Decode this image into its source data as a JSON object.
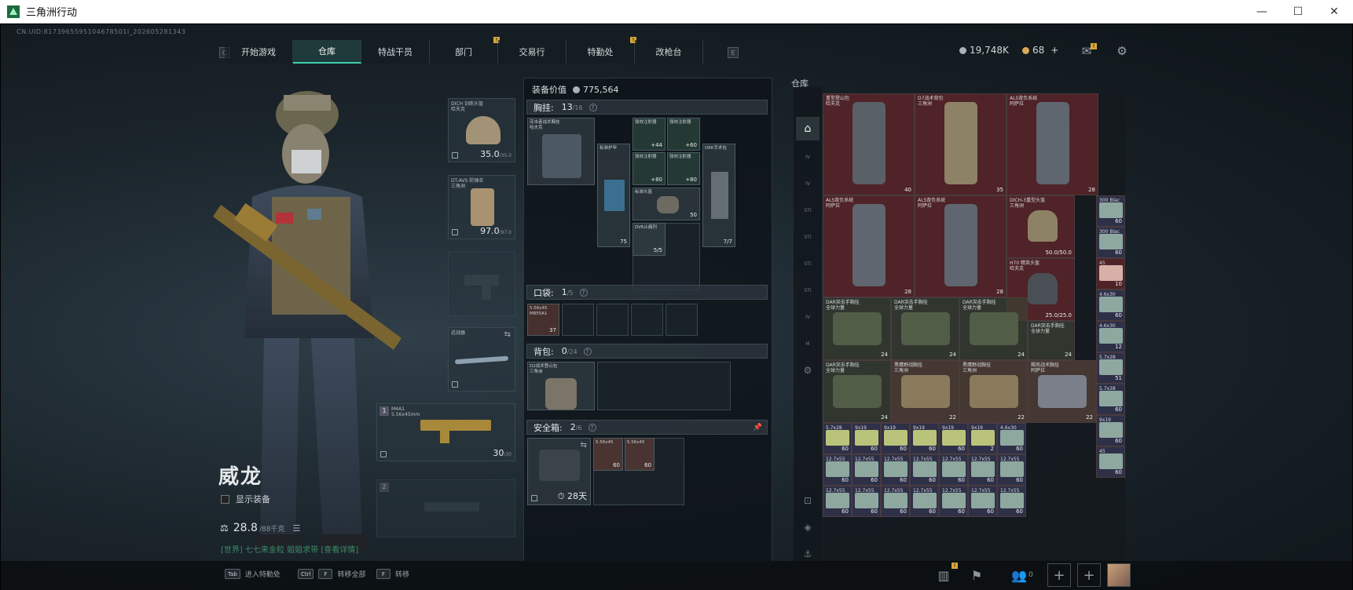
{
  "window": {
    "title": "三角洲行动",
    "minimize": "—",
    "maximize": "☐",
    "close": "✕"
  },
  "uid": "CN.UID:8173965595104678501I_202605281343",
  "nav": {
    "left_key": "Q",
    "right_key": "E",
    "tabs": [
      {
        "label": "开始游戏",
        "active": false,
        "badge": ""
      },
      {
        "label": "仓库",
        "active": true,
        "badge": ""
      },
      {
        "label": "特战干员",
        "active": false,
        "badge": ""
      },
      {
        "label": "部门",
        "active": false,
        "badge": "!"
      },
      {
        "label": "交易行",
        "active": false,
        "badge": ""
      },
      {
        "label": "特勤处",
        "active": false,
        "badge": "!"
      },
      {
        "label": "改枪台",
        "active": false,
        "badge": ""
      }
    ]
  },
  "currency": {
    "silver": "19,748K",
    "gold": "68",
    "plus": "+",
    "mail_badge": "!"
  },
  "character": {
    "name": "威龙",
    "show_equipment": "显示装备",
    "weight": "28.8",
    "weight_max": "/88千克",
    "chat": "[世界] 七七来金粒 姐姐求带 [查看详情]"
  },
  "gear": {
    "helmet": {
      "label": "DICH 训练头盔\n哈夫克",
      "value": "35.0",
      "max": "/35.0"
    },
    "armor": {
      "label": "DT-AVS 防弹衣\n三角洲",
      "value": "97.0",
      "max": "/97.0"
    },
    "melee": {
      "label": "近战器"
    },
    "primary": {
      "index": "1",
      "label": "M4A1\n5.56x45mm",
      "ammo": "30",
      "ammo_max": "/30"
    },
    "secondary": {
      "index": "2"
    }
  },
  "loadout": {
    "value_label": "装备价值",
    "value": "775,564",
    "chest": {
      "label": "胸挂:",
      "count": "13",
      "max": "/16",
      "rig": "突击者战术胸挂\n哈夫克",
      "items": [
        {
          "label": "标准护甲",
          "num": "75"
        },
        {
          "label": "强效注射器",
          "num": "+44"
        },
        {
          "label": "强效注射器",
          "num": "+60"
        },
        {
          "label": "强效注射器",
          "num": "+80"
        },
        {
          "label": "强效注射器",
          "num": "+80"
        },
        {
          "label": "DEK手术包",
          "num": "7/7"
        },
        {
          "label": "标准头盔",
          "num": "50"
        },
        {
          "label": "DV6止痛剂",
          "num": "5/5"
        }
      ]
    },
    "pocket": {
      "label": "口袋:",
      "count": "1",
      "max": "/5",
      "item": "5.56x45\nM855A1",
      "num": "37"
    },
    "backpack": {
      "label": "背包:",
      "count": "0",
      "max": "/24",
      "item": "D2战术登山包\n三角洲"
    },
    "safe": {
      "label": "安全箱:",
      "count": "2",
      "max": "/6",
      "days": "28天",
      "items": [
        {
          "label": "5.56x45",
          "num": "60"
        },
        {
          "label": "5.56x45",
          "num": "60"
        }
      ]
    }
  },
  "stash": {
    "title": "仓库",
    "items": [
      {
        "label": "重型登山包\n哈夫克",
        "num": "40"
      },
      {
        "label": "D7战术背包\n三角洲",
        "num": "35"
      },
      {
        "label": "ALS背负系统\n阿萨拉",
        "num": "28"
      },
      {
        "label": "ALS背负系统\n阿萨拉",
        "num": "28"
      },
      {
        "label": "ALS背负系统\n阿萨拉",
        "num": "28"
      },
      {
        "label": "DICH-3重型头盔\n三角洲",
        "num": "50.0/50.0"
      },
      {
        "label": "H70 精英头盔\n哈夫克",
        "num": "25.0/25.0"
      },
      {
        "label": "DAR突击手胸挂\n全球力量",
        "num": "24"
      },
      {
        "label": "DAR突击手胸挂\n全球力量",
        "num": "24"
      },
      {
        "label": "DAR突击手胸挂\n全球力量",
        "num": "24"
      },
      {
        "label": "DAR突击手胸挂\n全球力量",
        "num": "24"
      },
      {
        "label": "DAR突击手胸挂\n全球力量",
        "num": "24"
      },
      {
        "label": "黑鹰野战胸挂\n三角洲",
        "num": "22"
      },
      {
        "label": "黑鹰野战胸挂\n三角洲",
        "num": "22"
      },
      {
        "label": "飓风战术胸挂\n阿萨拉",
        "num": "22"
      }
    ],
    "ammo_labels": [
      "5.7x28",
      "9x19",
      "9x19",
      "9x19",
      "9x19",
      "9x19",
      "4.6x30",
      "12.7x55",
      "12.7x55",
      "12.7x55",
      "12.7x55",
      "12.7x55",
      "12.7x55",
      "12.7x55",
      "12.7x55",
      "12.7x55",
      "12.7x55",
      "12.7x55",
      "12.7x55",
      "12.7x55",
      "12.7x55"
    ],
    "ammo_nums": [
      "60",
      "60",
      "60",
      "60",
      "60",
      "2",
      "60",
      "60",
      "60",
      "60",
      "60",
      "60",
      "60",
      "60",
      "60",
      "60",
      "60",
      "60",
      "60",
      "60",
      "60"
    ],
    "side_labels": [
      "300 Blac",
      "300 Blac",
      "45",
      "4.6x30",
      "4.6x30",
      "5.7x28",
      "5.7x28",
      "9x19",
      "45"
    ],
    "side_nums": [
      "60",
      "60",
      "10",
      "60",
      "12",
      "51",
      "60",
      "60",
      "60"
    ]
  },
  "bottom": {
    "k1": "Tab",
    "t1": "进入特勤处",
    "k2": "Ctrl",
    "k2b": "F",
    "t2": "转移全部",
    "k3": "F",
    "t3": "转移",
    "friends": "0",
    "badge": "!"
  }
}
